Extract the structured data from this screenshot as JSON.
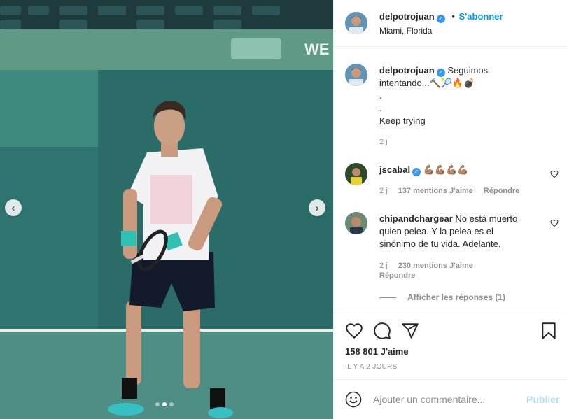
{
  "post": {
    "username": "delpotrojuan",
    "follow_separator": "•",
    "follow_label": "S'abonner",
    "location": "Miami, Florida"
  },
  "caption": {
    "username": "delpotrojuan",
    "line1": "Seguimos",
    "line2": "intentando...🔨🎾🔥💣",
    "line3": ".",
    "line4": ".",
    "line5": "Keep trying",
    "time": "2 j"
  },
  "comments": [
    {
      "username": "jscabal",
      "text": "💪🏽💪🏽💪🏽💪🏽",
      "time": "2 j",
      "likes": "137 mentions J'aime",
      "reply": "Répondre"
    },
    {
      "username": "chipandchargear",
      "text_line1": "No está muerto",
      "text_line2": "quien pelea. Y la pelea es el",
      "text_line3": "sinónimo de tu vida. Adelante.",
      "time": "2 j",
      "likes": "230 mentions J'aime",
      "reply": "Répondre",
      "show_replies": "Afficher les réponses (1)"
    }
  ],
  "actions": {
    "likes_count": "158 801 J'aime",
    "posted_ago": "IL Y A 2 JOURS"
  },
  "add_comment": {
    "placeholder": "Ajouter un commentaire...",
    "publish_label": "Publier"
  },
  "carousel": {
    "dots_total": 3,
    "active_index": 1
  },
  "colors": {
    "accent": "#0095f6",
    "verified": "#3897f0",
    "muted": "#8e8e8e",
    "court_blue": "#2f6f6a"
  },
  "icons": [
    "chevron-left-icon",
    "chevron-right-icon",
    "verified-badge-icon",
    "heart-icon",
    "comment-icon",
    "share-icon",
    "bookmark-icon",
    "emoji-icon"
  ]
}
